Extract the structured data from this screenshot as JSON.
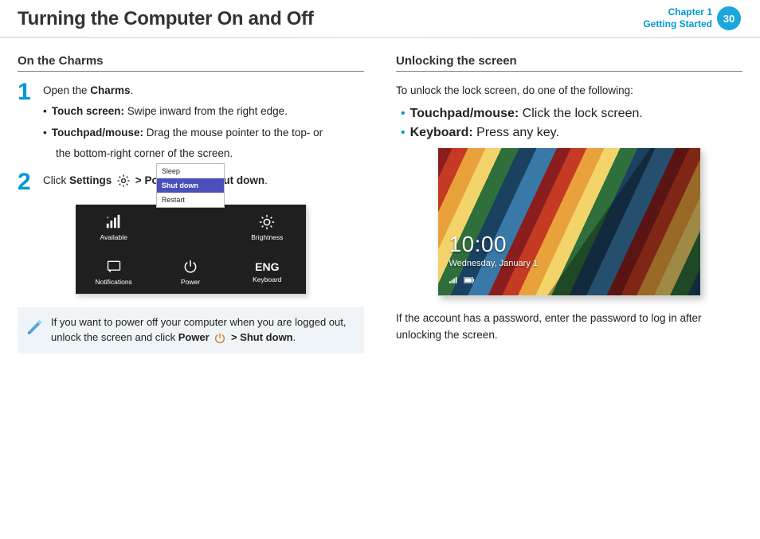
{
  "header": {
    "title": "Turning the Computer On and Off",
    "chapter_line1": "Chapter 1",
    "chapter_line2": "Getting Started",
    "page_number": "30"
  },
  "left": {
    "section_title": "On the Charms",
    "step1_num": "1",
    "step1_line": "Open the ",
    "step1_bold": "Charms",
    "step1_end": ".",
    "step1_b1_label": "Touch screen:",
    "step1_b1_text": " Swipe inward from the right edge.",
    "step1_b2_label": "Touchpad/mouse:",
    "step1_b2_text": " Drag the mouse pointer to the top- or",
    "step1_b2_cont": "the bottom-right corner of the screen.",
    "step2_num": "2",
    "s2_a": "Click ",
    "s2_settings": "Settings",
    "s2_b": " > ",
    "s2_power": "Power",
    "s2_c": " > ",
    "s2_shutdown": "Shut down",
    "s2_end": ".",
    "panel": {
      "available": "Available",
      "brightness": "Brightness",
      "notifications": "Notifications",
      "power": "Power",
      "keyboard": "Keyboard",
      "eng": "ENG",
      "menu_sleep": "Sleep",
      "menu_shutdown": "Shut down",
      "menu_restart": "Restart"
    },
    "callout_a": "If you want to power off your computer when you are logged out, unlock the screen and click ",
    "callout_power": "Power",
    "callout_b": " > ",
    "callout_sd": "Shut down",
    "callout_end": "."
  },
  "right": {
    "section_title": "Unlocking the screen",
    "intro": "To unlock the lock screen, do one of the following:",
    "b1_label": "Touchpad/mouse:",
    "b1_text": " Click the lock screen.",
    "b2_label": "Keyboard:",
    "b2_text": " Press any key.",
    "lock": {
      "time": "10:00",
      "date": "Wednesday, January 1"
    },
    "aftertext": "If the account has a password, enter the password to log in after unlocking the screen."
  }
}
